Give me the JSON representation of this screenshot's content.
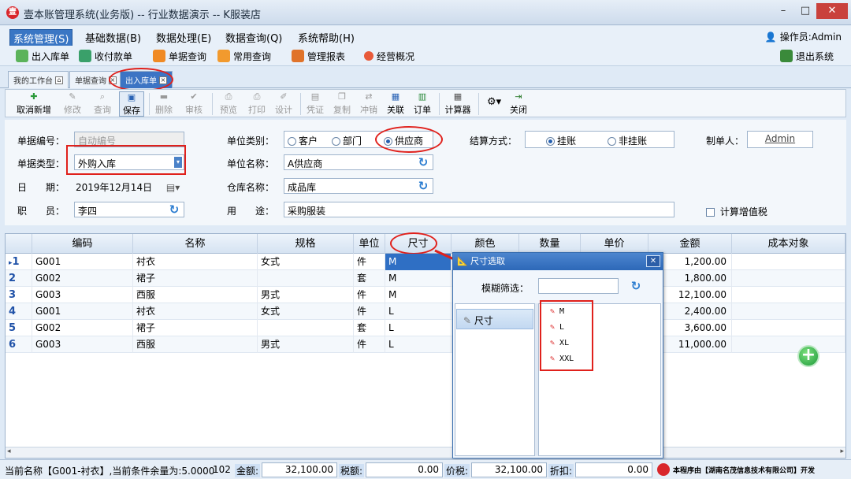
{
  "window": {
    "title": "壹本账管理系统(业务版) -- 行业数据演示 -- K服装店",
    "min_glyph": "–",
    "max_glyph": "□",
    "close_glyph": "✕"
  },
  "menu": {
    "items": [
      "系统管理(S)",
      "基础数据(B)",
      "数据处理(E)",
      "数据查询(Q)",
      "系统帮助(H)"
    ],
    "operator": "操作员:Admin"
  },
  "quickbar": {
    "items": [
      "出入库单",
      "收付款单",
      "单据查询",
      "常用查询",
      "管理报表",
      "经营概况"
    ],
    "exit": "退出系统"
  },
  "tabs": [
    "我的工作台",
    "单据查询",
    "出入库单"
  ],
  "actions": {
    "cancel_new": "取消新增",
    "edit": "修改",
    "query": "查询",
    "save": "保存",
    "delete": "删除",
    "audit": "审核",
    "preview": "预览",
    "print": "打印",
    "design": "设计",
    "voucher": "凭证",
    "copy": "复制",
    "offset": "冲销",
    "link": "关联",
    "order": "订单",
    "calculator": "计算器",
    "close": "关闭"
  },
  "form": {
    "doc_no_label": "单据编号：",
    "doc_no_value": "自动编号",
    "doc_type_label": "单据类型：",
    "doc_type_value": "外购入库",
    "date_label": "日　　期：",
    "date_value": "2019年12月14日",
    "staff_label": "职　　员：",
    "staff_value": "李四",
    "unit_type_label": "单位类别：",
    "unit_type_options": [
      "客户",
      "部门",
      "供应商"
    ],
    "unit_type_selected": "供应商",
    "unit_name_label": "单位名称：",
    "unit_name_value": "A供应商",
    "warehouse_label": "仓库名称：",
    "warehouse_value": "成品库",
    "purpose_label": "用　　途：",
    "purpose_value": "采购服装",
    "settle_label": "结算方式：",
    "settle_options": [
      "挂账",
      "非挂账"
    ],
    "settle_selected": "挂账",
    "maker_label": "制单人：",
    "maker_value": "Admin",
    "vat_label": "计算增值税"
  },
  "grid": {
    "columns": [
      "编码",
      "名称",
      "规格",
      "单位",
      "尺寸",
      "颜色",
      "数量",
      "单价",
      "金额",
      "成本对象"
    ],
    "rows": [
      {
        "no": "1",
        "code": "G001",
        "name": "衬衣",
        "spec": "女式",
        "unit": "件",
        "size": "M",
        "amount": "1,200.00"
      },
      {
        "no": "2",
        "code": "G002",
        "name": "裙子",
        "spec": "",
        "unit": "套",
        "size": "M",
        "amount": "1,800.00"
      },
      {
        "no": "3",
        "code": "G003",
        "name": "西服",
        "spec": "男式",
        "unit": "件",
        "size": "M",
        "amount": "12,100.00"
      },
      {
        "no": "4",
        "code": "G001",
        "name": "衬衣",
        "spec": "女式",
        "unit": "件",
        "size": "L",
        "amount": "2,400.00"
      },
      {
        "no": "5",
        "code": "G002",
        "name": "裙子",
        "spec": "",
        "unit": "套",
        "size": "L",
        "amount": "3,600.00"
      },
      {
        "no": "6",
        "code": "G003",
        "name": "西服",
        "spec": "男式",
        "unit": "件",
        "size": "L",
        "amount": "11,000.00"
      }
    ]
  },
  "popup": {
    "title": "尺寸选取",
    "filter_label": "模糊筛选：",
    "filter_value": "",
    "category": "尺寸",
    "sizes": [
      "M",
      "L",
      "XL",
      "XXL"
    ]
  },
  "status": {
    "current": "当前名称【G001-衬衣】,当前条件余量为:5.0000",
    "count": "102",
    "amount_label": "金额:",
    "amount_value": "32,100.00",
    "tax_label": "税额:",
    "tax_value": "0.00",
    "tax_incl_label": "价税:",
    "tax_incl_value": "32,100.00",
    "discount_label": "折扣:",
    "discount_value": "0.00",
    "footer": "本程序由【湖南名茂信息技术有限公司】开发"
  },
  "colors": {
    "accent": "#3a76c4",
    "annotation": "#e0211c"
  }
}
